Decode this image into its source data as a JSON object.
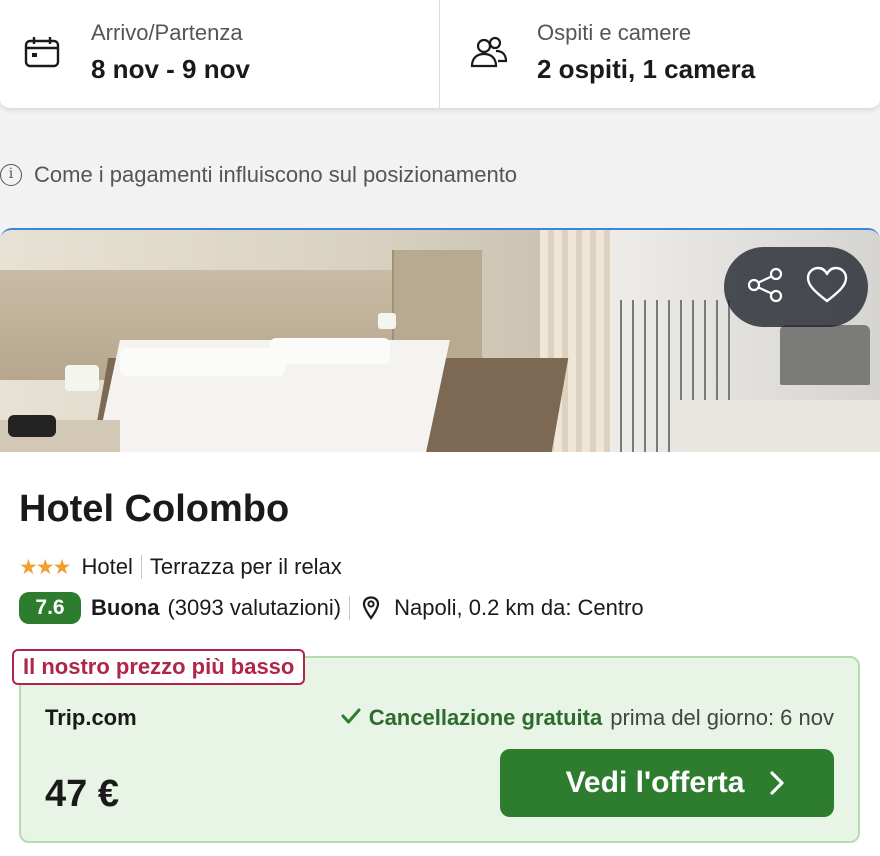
{
  "search": {
    "dates_label": "Arrivo/Partenza",
    "dates_value": "8 nov - 9 nov",
    "guests_label": "Ospiti e camere",
    "guests_value": "2 ospiti, 1 camera"
  },
  "info": {
    "text": "Come i pagamenti influiscono sul posizionamento"
  },
  "hotel": {
    "name": "Hotel Colombo",
    "stars": 3,
    "type": "Hotel",
    "feature": "Terrazza per il relax",
    "score": "7.6",
    "rating_word": "Buona",
    "reviews": "(3093 valutazioni)",
    "location": "Napoli, 0.2 km da: Centro"
  },
  "offer": {
    "badge": "Il nostro prezzo più basso",
    "provider": "Trip.com",
    "cancel_strong": "Cancellazione gratuita",
    "cancel_rest": "prima del giorno: 6 nov",
    "price": "47 €",
    "cta": "Vedi l'offerta"
  },
  "colors": {
    "accent_green": "#2e7d2e",
    "badge_red": "#b0264a",
    "offer_bg": "#e8f5e6",
    "star": "#f0a030"
  },
  "icons": {
    "dates": "calendar-icon",
    "guests": "users-icon",
    "info": "info-icon",
    "share": "share-icon",
    "favorite": "heart-icon",
    "location": "map-pin-icon",
    "check": "check-icon",
    "chevron": "chevron-right-icon"
  }
}
